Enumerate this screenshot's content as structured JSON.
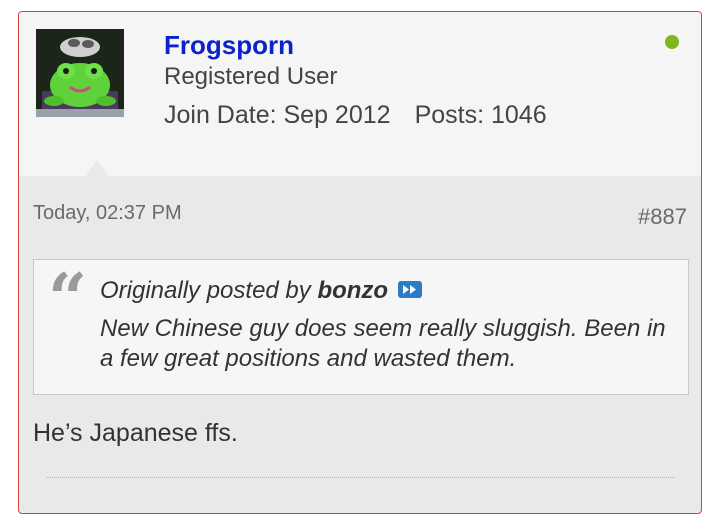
{
  "user": {
    "username": "Frogsporn",
    "title": "Registered User",
    "join_date": "Join Date: Sep 2012",
    "posts": "Posts: 1046",
    "online_color": "#7fb51f",
    "avatar_icon": "frog-avatar"
  },
  "post": {
    "date": "Today, 02:37 PM",
    "number": "#887",
    "message": "He’s Japanese ffs."
  },
  "quote": {
    "prefix": "Originally posted by",
    "author": "bonzo",
    "view_icon": "view-post-icon",
    "text": "New Chinese guy does seem really sluggish. Been in a few great positions and wasted them."
  },
  "colors": {
    "border": "#d9413f",
    "username": "#0b23c9",
    "view_button": "#2a7dc4"
  }
}
